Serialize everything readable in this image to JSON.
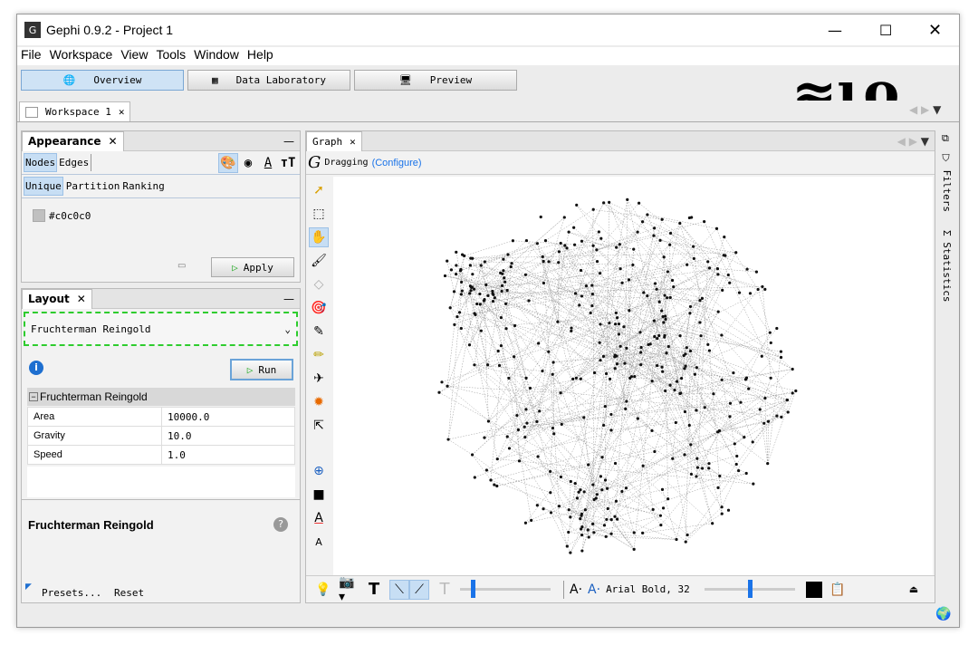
{
  "window": {
    "title": "Gephi 0.9.2 - Project 1"
  },
  "menu": [
    "File",
    "Workspace",
    "View",
    "Tools",
    "Window",
    "Help"
  ],
  "modes": {
    "overview": "Overview",
    "data_lab": "Data Laboratory",
    "preview": "Preview"
  },
  "workspace_tab": "Workspace 1",
  "appearance": {
    "title": "Appearance",
    "tabs": [
      "Nodes",
      "Edges"
    ],
    "subtabs": [
      "Unique",
      "Partition",
      "Ranking"
    ],
    "color_value": "#c0c0c0",
    "apply": "Apply"
  },
  "layout": {
    "title": "Layout",
    "algorithm": "Fruchterman Reingold",
    "run": "Run",
    "section": "Fruchterman Reingold",
    "properties": [
      {
        "name": "Area",
        "value": "10000.0"
      },
      {
        "name": "Gravity",
        "value": "10.0"
      },
      {
        "name": "Speed",
        "value": "1.0"
      }
    ],
    "description_title": "Fruchterman Reingold",
    "presets": "Presets...",
    "reset": "Reset"
  },
  "graph": {
    "tab": "Graph",
    "mode": "Dragging",
    "configure": "(Configure)",
    "font_label": "Arial Bold, 32"
  },
  "side": {
    "filters": "Filters",
    "statistics": "Statistics"
  },
  "colors": {
    "accent": "#1a73e8",
    "highlight_border": "#2ecc2e"
  }
}
